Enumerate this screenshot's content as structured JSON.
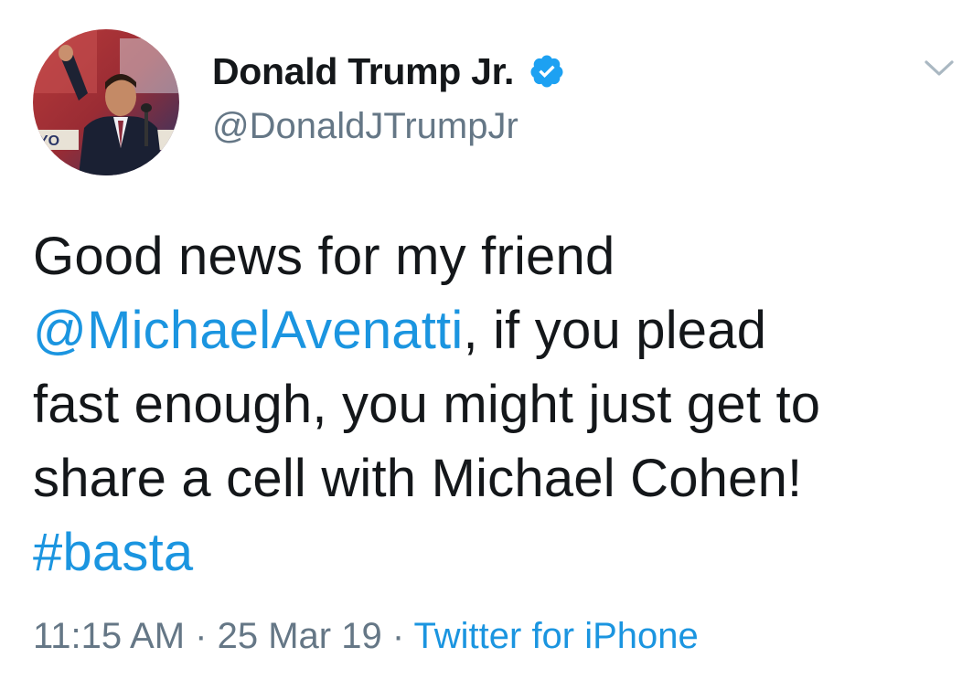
{
  "author": {
    "display_name": "Donald Trump Jr.",
    "handle": "@DonaldJTrumpJr",
    "verified_icon": "verified-badge-icon",
    "avatar_icon": "profile-photo"
  },
  "menu": {
    "icon": "chevron-down-icon"
  },
  "tweet": {
    "line1": "Good news for my friend",
    "mention": "@MichaelAvenatti",
    "line2_rest": ", if you plead",
    "line3": "fast enough, you might just get to",
    "line4": "share a cell with Michael Cohen!",
    "hashtag": "#basta"
  },
  "meta": {
    "time": "11:15 AM",
    "separator1": " · ",
    "date": "25 Mar 19",
    "separator2": " · ",
    "source": "Twitter for iPhone"
  },
  "colors": {
    "link": "#1b95e0",
    "secondary_text": "#657786",
    "primary_text": "#14171a",
    "verified": "#1da1f2"
  }
}
